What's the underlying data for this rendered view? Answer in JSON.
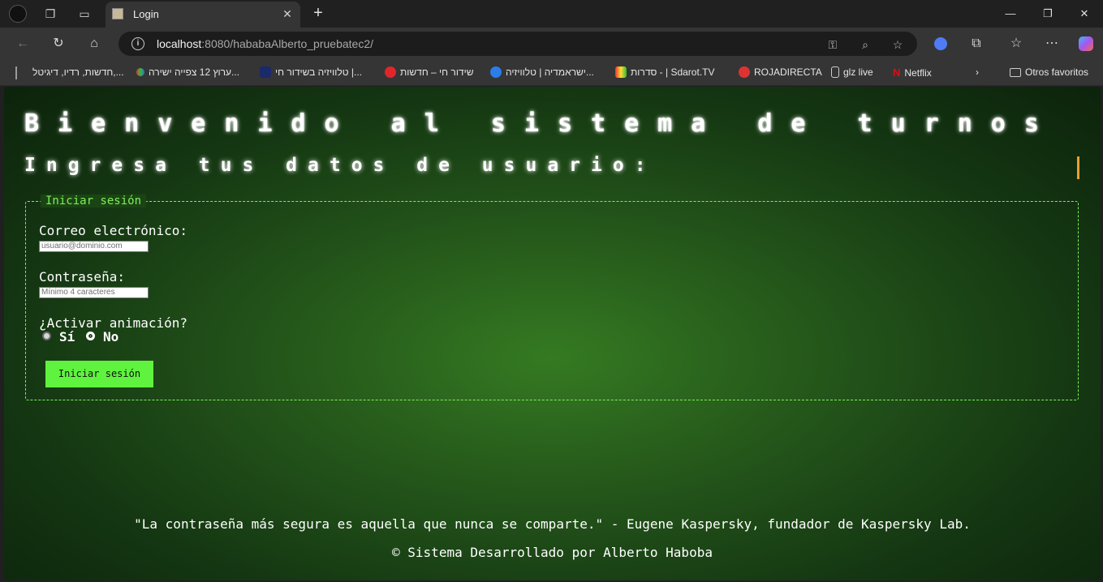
{
  "browser": {
    "tab_title": "Login",
    "url_host": "localhost",
    "url_rest": ":8080/hababaAlberto_pruebatec2/",
    "bookmarks": [
      "חדשות, רדיו, דיגיטל,...",
      "ערוץ 12 צפייה ישירה...",
      "טלוויזיה בשידור חי |...",
      "שידור חי – חדשות",
      "ישראמדיה | טלוויזיה...",
      "סדרות - | Sdarot.TV",
      "ROJADIRECTA",
      "glz live",
      "Netflix"
    ],
    "other_favorites": "Otros favoritos"
  },
  "page": {
    "title": "Bienvenido al sistema de turnos",
    "subtitle": "Ingresa tus datos de usuario:",
    "form": {
      "legend": "Iniciar sesión",
      "email_label": "Correo electrónico:",
      "email_placeholder": "usuario@dominio.com",
      "password_label": "Contraseña:",
      "password_placeholder": "Mínimo 4 caracteres",
      "animation_label": "¿Activar animación?",
      "option_yes": "Sí",
      "option_no": "No",
      "selected_option": "No",
      "submit_label": "Iniciar sesión"
    },
    "quote": "\"La contraseña más segura es aquella que nunca se comparte.\" - Eugene Kaspersky, fundador de Kaspersky Lab.",
    "copyright": "© Sistema Desarrollado por Alberto Haboba"
  },
  "colors": {
    "accent_green": "#5ff23e",
    "legend_green": "#7df05a",
    "background_green": "#24561a"
  }
}
